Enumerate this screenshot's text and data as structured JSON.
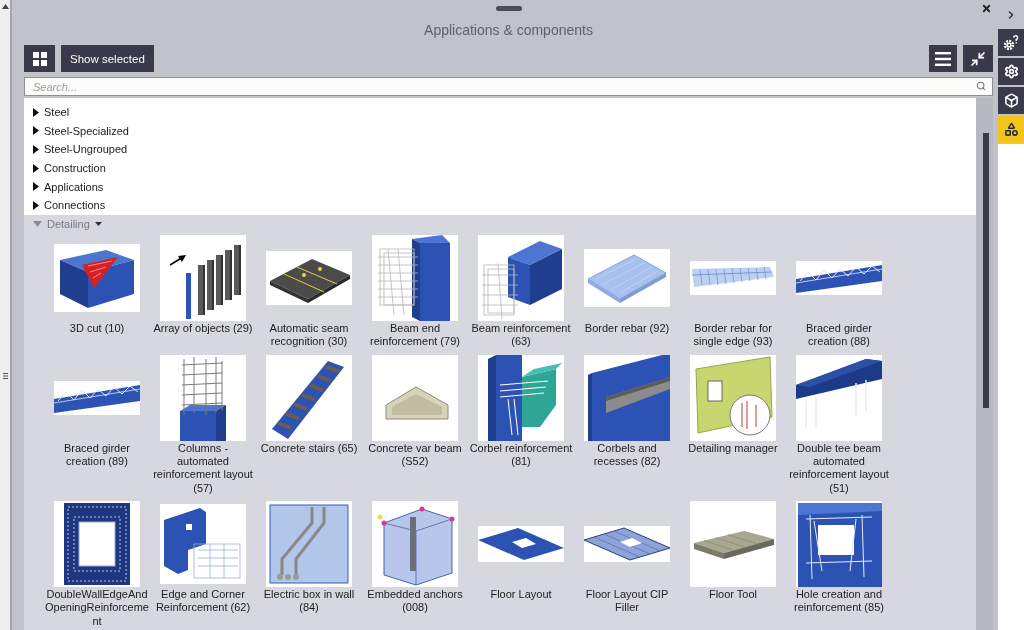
{
  "window": {
    "title": "Applications & components"
  },
  "toolbar": {
    "show_selected": "Show selected"
  },
  "search": {
    "placeholder": "Search..."
  },
  "side_tabs": [
    {
      "kind": "help",
      "selected": false
    },
    {
      "kind": "settings",
      "selected": false
    },
    {
      "kind": "cube",
      "selected": false
    },
    {
      "kind": "shapes",
      "selected": true
    }
  ],
  "categories": [
    {
      "label": "Steel",
      "expanded": false
    },
    {
      "label": "Steel-Specialized",
      "expanded": false
    },
    {
      "label": "Steel-Ungrouped",
      "expanded": false
    },
    {
      "label": "Construction",
      "expanded": false
    },
    {
      "label": "Applications",
      "expanded": false
    },
    {
      "label": "Connections",
      "expanded": false
    },
    {
      "label": "Detailing",
      "expanded": true,
      "children": [
        {
          "label": "3D cut (10)",
          "kind": "cut"
        },
        {
          "label": "Array of objects (29)",
          "kind": "array"
        },
        {
          "label": "Automatic seam recognition (30)",
          "kind": "seam"
        },
        {
          "label": "Beam end reinforcement (79)",
          "kind": "beam"
        },
        {
          "label": "Beam reinforcement (63)",
          "kind": "beamh"
        },
        {
          "label": "Border rebar (92)",
          "kind": "slab"
        },
        {
          "label": "Border rebar for single edge (93)",
          "kind": "slabedge"
        },
        {
          "label": "Braced girder creation (88)",
          "kind": "girder"
        },
        {
          "label": "Braced girder creation (89)",
          "kind": "girder"
        },
        {
          "label": "Columns - automated reinforcement layout (57)",
          "kind": "columncage"
        },
        {
          "label": "Concrete stairs (65)",
          "kind": "stairs"
        },
        {
          "label": "Concrete var beam (S52)",
          "kind": "varbeam"
        },
        {
          "label": "Corbel reinforcement (81)",
          "kind": "corbel"
        },
        {
          "label": "Corbels and recesses (82)",
          "kind": "recess"
        },
        {
          "label": "Detailing manager",
          "kind": "wallpanel"
        },
        {
          "label": "Double tee beam automated reinforcement layout (51)",
          "kind": "doubletee"
        },
        {
          "label": "DoubleWallEdgeAndOpeningReinforcement",
          "kind": "wallopening"
        },
        {
          "label": "Edge and Corner Reinforcement (62)",
          "kind": "edge"
        },
        {
          "label": "Electric box in wall (84)",
          "kind": "electric"
        },
        {
          "label": "Embedded anchors (008)",
          "kind": "anchor"
        },
        {
          "label": "Floor Layout",
          "kind": "floor"
        },
        {
          "label": "Floor Layout CIP Filler",
          "kind": "floorfill"
        },
        {
          "label": "Floor Tool",
          "kind": "floortool"
        },
        {
          "label": "Hole creation and reinforcement (85)",
          "kind": "hole"
        }
      ]
    }
  ]
}
